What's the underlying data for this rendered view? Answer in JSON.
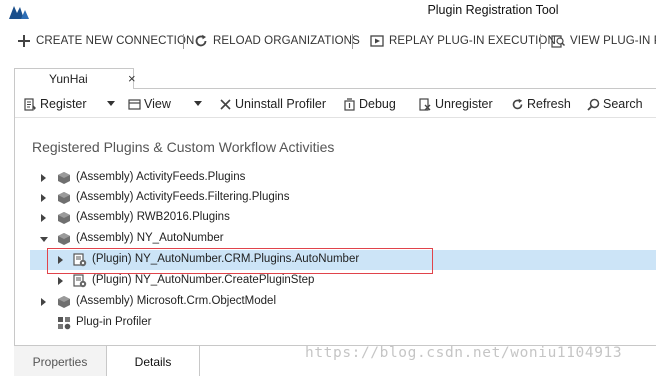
{
  "window": {
    "title": "Plugin Registration Tool",
    "logo_icon": "dynamics-logo-icon"
  },
  "main_toolbar": {
    "items": [
      {
        "label": "CREATE NEW CONNECTION",
        "icon": "plus-icon"
      },
      {
        "label": "RELOAD ORGANIZATIONS",
        "icon": "reload-icon"
      },
      {
        "label": "REPLAY PLUG-IN EXECUTION",
        "icon": "replay-icon"
      },
      {
        "label": "VIEW PLUG-IN PR",
        "icon": "view-profile-icon"
      }
    ]
  },
  "document_tab": {
    "label": "YunHai",
    "close": "×"
  },
  "toolbar": {
    "register": "Register",
    "view": "View",
    "uninstall_profiler": "Uninstall Profiler",
    "debug": "Debug",
    "unregister": "Unregister",
    "refresh": "Refresh",
    "search": "Search"
  },
  "section_title": "Registered Plugins & Custom Workflow Activities",
  "tree": [
    {
      "label": "(Assembly) ActivityFeeds.Plugins",
      "icon": "assembly-icon",
      "expander": "collapsed",
      "level": 0,
      "selected": false
    },
    {
      "label": "(Assembly) ActivityFeeds.Filtering.Plugins",
      "icon": "assembly-icon",
      "expander": "collapsed",
      "level": 0,
      "selected": false
    },
    {
      "label": "(Assembly) RWB2016.Plugins",
      "icon": "assembly-icon",
      "expander": "collapsed",
      "level": 0,
      "selected": false
    },
    {
      "label": "(Assembly) NY_AutoNumber",
      "icon": "assembly-icon",
      "expander": "expanded",
      "level": 0,
      "selected": false
    },
    {
      "label": "(Plugin) NY_AutoNumber.CRM.Plugins.AutoNumber",
      "icon": "plugin-icon",
      "expander": "collapsed",
      "level": 1,
      "selected": true
    },
    {
      "label": "(Plugin) NY_AutoNumber.CreatePluginStep",
      "icon": "plugin-icon",
      "expander": "collapsed",
      "level": 1,
      "selected": false
    },
    {
      "label": "(Assembly) Microsoft.Crm.ObjectModel",
      "icon": "assembly-icon",
      "expander": "collapsed",
      "level": 0,
      "selected": false
    },
    {
      "label": "Plug-in Profiler",
      "icon": "profiler-icon",
      "expander": "none",
      "level": 0,
      "selected": false
    }
  ],
  "bottom_tabs": {
    "properties": "Properties",
    "details": "Details",
    "active": "Details"
  },
  "watermark": "https://blog.csdn.net/woniu1104913",
  "colors": {
    "selection": "#cce4f7",
    "highlight_border": "#e0434b",
    "brand_blue": "#1a4f8b"
  }
}
